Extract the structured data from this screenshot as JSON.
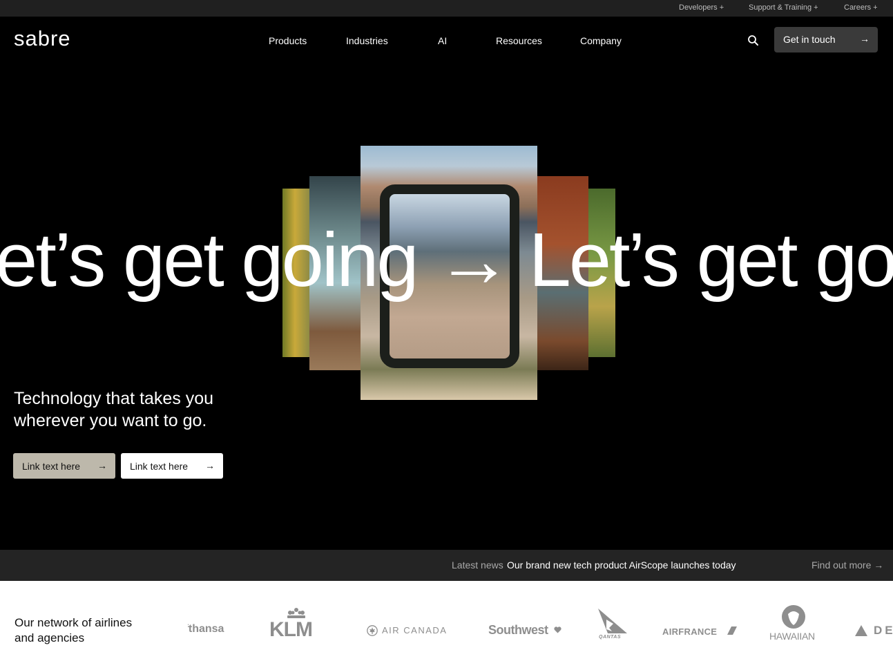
{
  "utility": {
    "links": [
      "Developers +",
      "Support & Training +",
      "Careers +"
    ]
  },
  "nav": {
    "brand": "sabre",
    "items": [
      "Products",
      "Industries",
      "AI",
      "Resources",
      "Company"
    ],
    "search_icon": "search-icon",
    "cta_label": "Get in touch",
    "arrow": "→"
  },
  "hero": {
    "marquee_text": "Let’s get going → Let’s get going → Let’s get going →",
    "tagline": "Technology that takes you wherever you want to go.",
    "buttons": [
      {
        "label": "Link text here",
        "arrow": "→"
      },
      {
        "label": "Link text here",
        "arrow": "→"
      }
    ]
  },
  "news": {
    "label": "Latest news",
    "headline": "Our brand new tech product AirScope launches today",
    "more": "Find out more →"
  },
  "partners": {
    "heading": "Our network of airlines and agencies",
    "logos": [
      "Lufthansa",
      "KLM",
      "AIR CANADA",
      "Southwest",
      "QANTAS",
      "AIRFRANCE",
      "HAWAIIAN",
      "DELTA"
    ]
  },
  "colors": {
    "background": "#000000",
    "utility_bar": "#202020",
    "news_bar": "#242424",
    "cta_button": "#3a3a3a",
    "primary_link_button": "#bdb8ab"
  }
}
